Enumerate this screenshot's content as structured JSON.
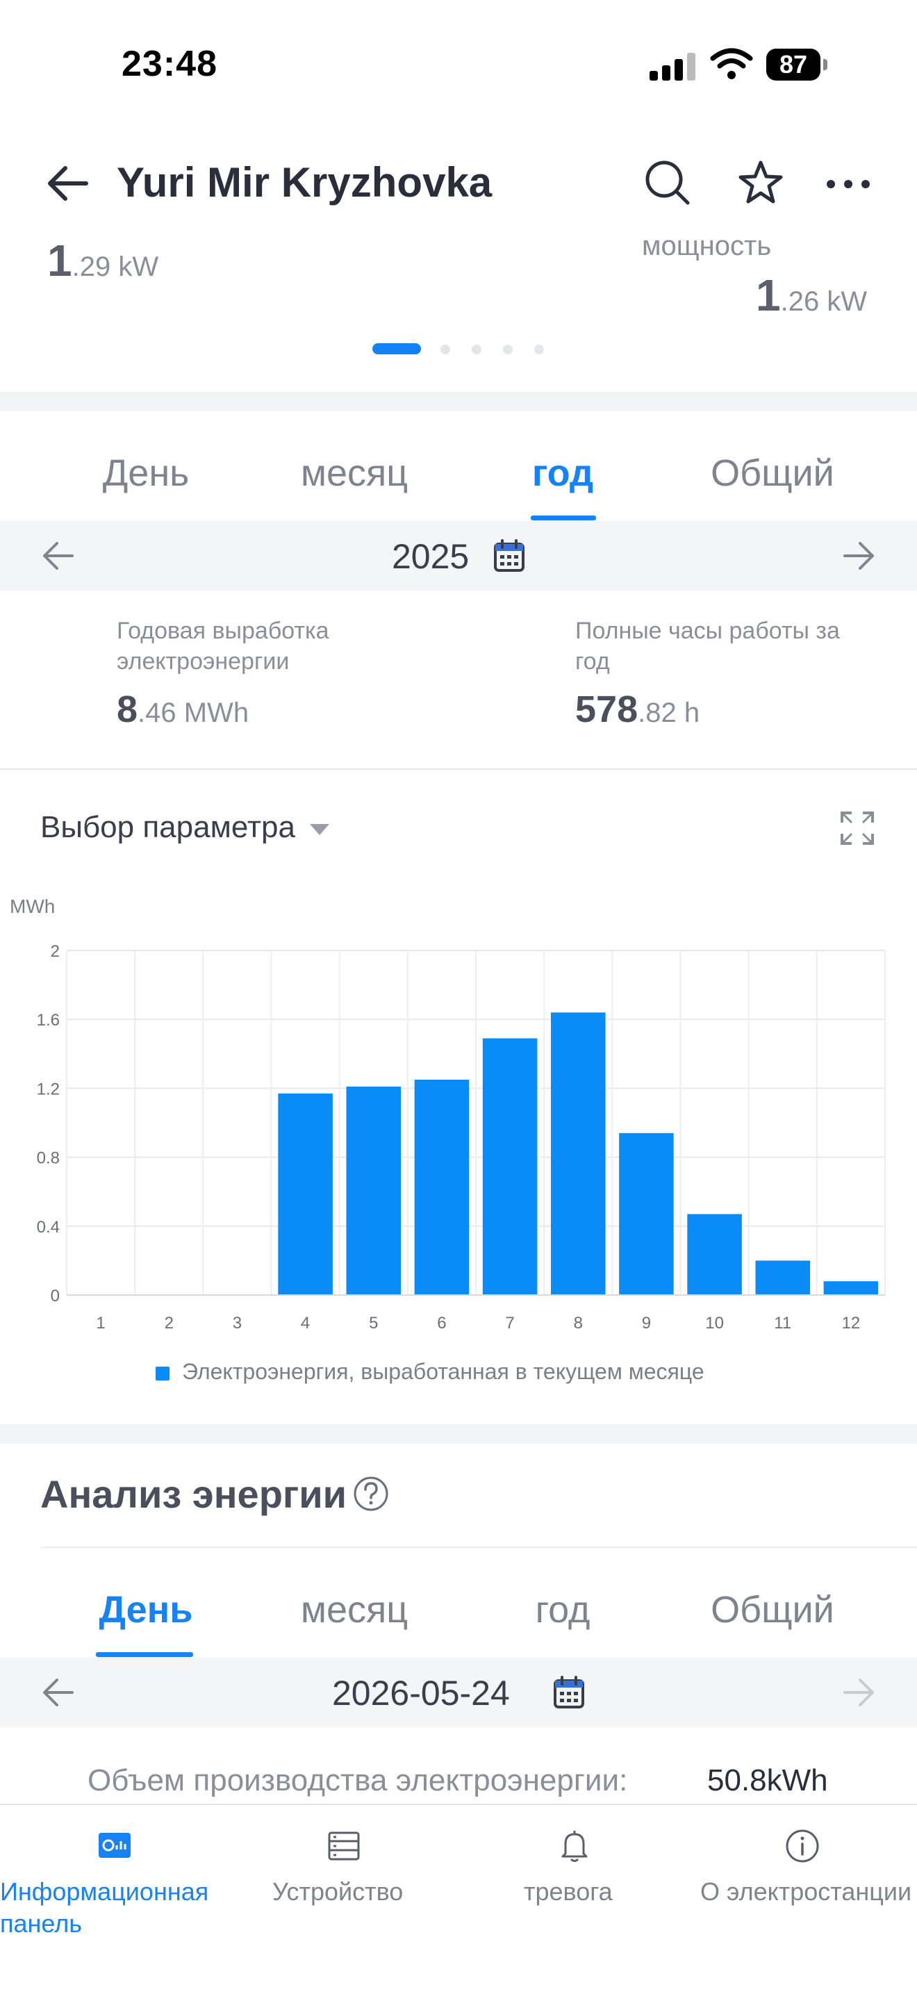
{
  "status_bar": {
    "time": "23:48",
    "battery": "87"
  },
  "header": {
    "title": "Yuri Mir Kryzhovka",
    "power_left": {
      "int": "1",
      "dec": ".29 kW"
    },
    "power_right": {
      "label": "мощность",
      "int": "1",
      "dec": ".26 kW"
    }
  },
  "tabs_top": [
    "День",
    "месяц",
    "год",
    "Общий"
  ],
  "tabs_top_active": "год",
  "date_top": "2025",
  "stats": {
    "annual_label": "Годовая выработка электроэнергии",
    "annual_int": "8",
    "annual_dec": ".46 MWh",
    "hours_label": "Полные часы работы за год",
    "hours_int": "578",
    "hours_dec": ".82 h"
  },
  "param_select": "Выбор параметра",
  "chart_data": {
    "type": "bar",
    "ylabel": "MWh",
    "ylim": [
      0,
      2
    ],
    "yticks": [
      "0",
      "0.4",
      "0.8",
      "1.2",
      "1.6",
      "2"
    ],
    "categories": [
      "1",
      "2",
      "3",
      "4",
      "5",
      "6",
      "7",
      "8",
      "9",
      "10",
      "11",
      "12"
    ],
    "series": [
      {
        "name": "Электроэнергия, выработанная в текущем месяце",
        "values": [
          0,
          0,
          0,
          1.17,
          1.21,
          1.25,
          1.49,
          1.64,
          0.94,
          0.47,
          0.2,
          0.08
        ]
      }
    ],
    "color": "#0a8cf8",
    "grid": true,
    "legend": "bottom"
  },
  "energy_analysis": {
    "title": "Анализ энергии",
    "tabs": [
      "День",
      "месяц",
      "год",
      "Общий"
    ],
    "active_tab": "День",
    "date": "2026-05-24",
    "production_label": "Объем производства электроэнергии:",
    "production_value": "50.8kWh"
  },
  "bottom_nav": [
    {
      "label": "Информационная панель",
      "icon": "dashboard-icon",
      "active": true
    },
    {
      "label": "Устройство",
      "icon": "device-icon",
      "active": false
    },
    {
      "label": "тревога",
      "icon": "bell-icon",
      "active": false
    },
    {
      "label": "О электростанции",
      "icon": "info-icon",
      "active": false
    }
  ],
  "colors": {
    "accent": "#1682f4",
    "bar": "#0a8cf8"
  }
}
